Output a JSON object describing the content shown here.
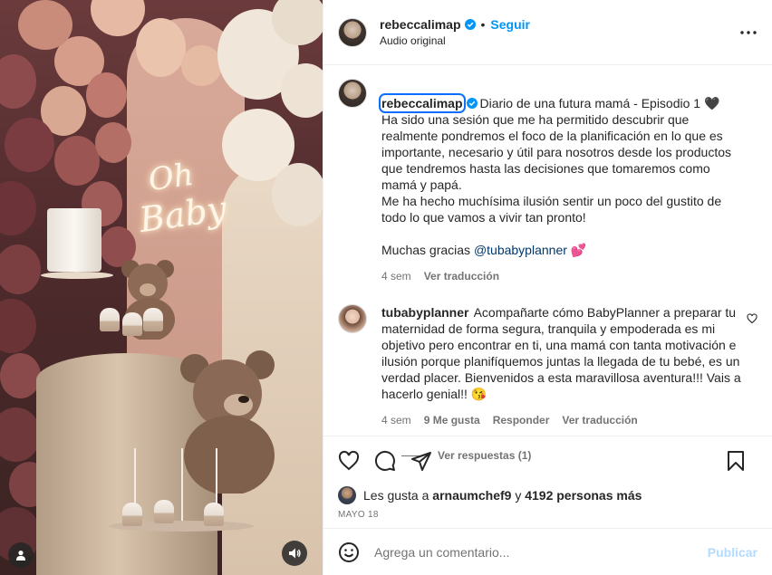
{
  "header": {
    "username": "rebeccalimap",
    "separator": "•",
    "follow_label": "Seguir",
    "subtitle": "Audio original"
  },
  "caption": {
    "username": "rebeccalimap",
    "lines": [
      "Diario de una futura mamá - Episodio 1 🖤",
      "Ha sido una sesión que me ha permitido descubrir que realmente pondremos el foco de la planificación en lo que es importante, necesario y útil para nosotros desde los productos que tendremos hasta las decisiones que tomaremos como mamá y papá.",
      "Me ha hecho muchísima ilusión sentir un poco del gustito de todo lo que vamos a vivir tan pronto!"
    ],
    "thanks_prefix": "Muchas gracias ",
    "mention": "@tubabyplanner",
    "thanks_emoji": " 💕",
    "time": "4 sem",
    "translate_label": "Ver traducción"
  },
  "comment": {
    "username": "tubabyplanner",
    "text": "Acompañarte cómo BabyPlanner a preparar tu maternidad de forma segura, tranquila y empoderada es mi objetivo pero encontrar en ti, una mamá con tanta motivación e ilusión porque planifíquemos juntas la llegada de tu bebé, es un verdad placer. Bienvenidos a esta maravillosa aventura!!! Vais a hacerlo genial!! 😘",
    "time": "4 sem",
    "likes_label": "9 Me gusta",
    "reply_label": "Responder",
    "translate_label": "Ver traducción",
    "view_replies_label": "Ver respuestas (1)"
  },
  "neon_sign": {
    "line1": "Oh",
    "line2": "Baby"
  },
  "likes": {
    "prefix": "Les gusta a ",
    "user": "arnaumchef9",
    "middle": " y ",
    "count_label": "4192 personas más"
  },
  "date": "MAYO 18",
  "composer": {
    "placeholder": "Agrega un comentario...",
    "post_label": "Publicar"
  },
  "icons": {
    "more": "more-options-icon",
    "verified": "verified-badge-icon",
    "like": "heart-icon",
    "comment": "comment-bubble-icon",
    "share": "paper-plane-icon",
    "save": "bookmark-icon",
    "emoji": "smiley-icon",
    "mute": "speaker-icon",
    "tagged": "user-tag-icon"
  },
  "colors": {
    "accent": "#0095f6",
    "verified": "#0095f6",
    "mention": "#00376b",
    "muted_text": "#737373",
    "post_disabled": "#b3dbff"
  }
}
